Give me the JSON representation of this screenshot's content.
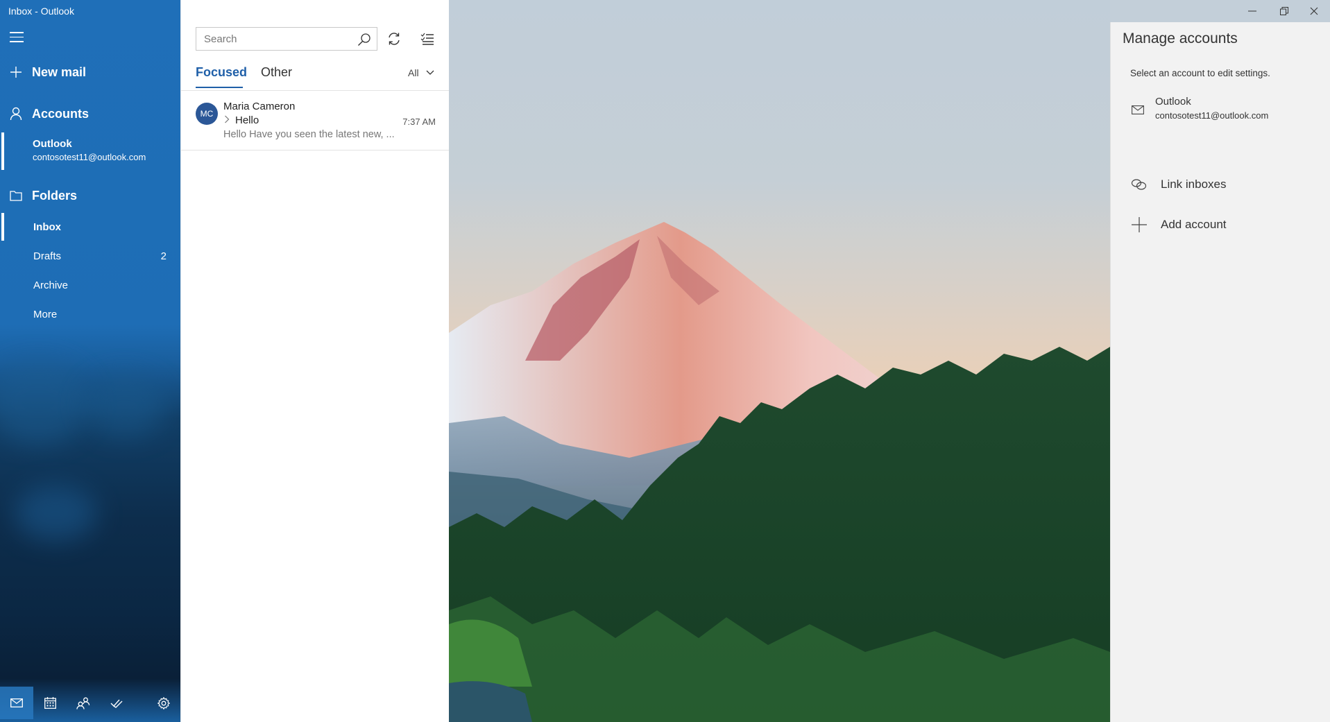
{
  "window": {
    "title": "Inbox - Outlook",
    "controls": {
      "minimize": "minimize",
      "restore": "restore",
      "close": "close"
    }
  },
  "sidebar": {
    "menu_icon": "hamburger-icon",
    "new_mail": {
      "label": "New mail",
      "icon": "plus-icon"
    },
    "accounts": {
      "label": "Accounts",
      "icon": "person-icon"
    },
    "account": {
      "name": "Outlook",
      "email": "contosotest11@outlook.com"
    },
    "folders": {
      "label": "Folders",
      "icon": "folder-icon",
      "items": [
        {
          "label": "Inbox",
          "count": "",
          "selected": true
        },
        {
          "label": "Drafts",
          "count": "2",
          "selected": false
        },
        {
          "label": "Archive",
          "count": "",
          "selected": false
        },
        {
          "label": "More",
          "count": "",
          "selected": false
        }
      ]
    },
    "bottom_nav": [
      {
        "icon": "mail-icon",
        "active": true
      },
      {
        "icon": "calendar-icon",
        "active": false
      },
      {
        "icon": "people-icon",
        "active": false
      },
      {
        "icon": "todo-icon",
        "active": false
      },
      {
        "icon": "settings-icon",
        "active": false
      }
    ]
  },
  "message_list": {
    "search": {
      "placeholder": "Search",
      "value": ""
    },
    "tabs": [
      {
        "label": "Focused",
        "active": true
      },
      {
        "label": "Other",
        "active": false
      }
    ],
    "filter": {
      "label": "All"
    },
    "messages": [
      {
        "initials": "MC",
        "from": "Maria Cameron",
        "subject": "Hello",
        "time": "7:37 AM",
        "preview": "Hello Have you seen the latest new, ...",
        "avatar_color": "#2b5797"
      }
    ]
  },
  "manage_accounts": {
    "title": "Manage accounts",
    "hint": "Select an account to edit settings.",
    "accounts": [
      {
        "name": "Outlook",
        "email": "contosotest11@outlook.com",
        "icon": "mail-icon"
      }
    ],
    "actions": [
      {
        "label": "Link inboxes",
        "icon": "link-icon"
      },
      {
        "label": "Add account",
        "icon": "plus-icon"
      }
    ]
  },
  "colors": {
    "accent": "#1f5fa8",
    "sidebar": "#1f6fb8",
    "panel_bg": "#f2f2f2"
  }
}
